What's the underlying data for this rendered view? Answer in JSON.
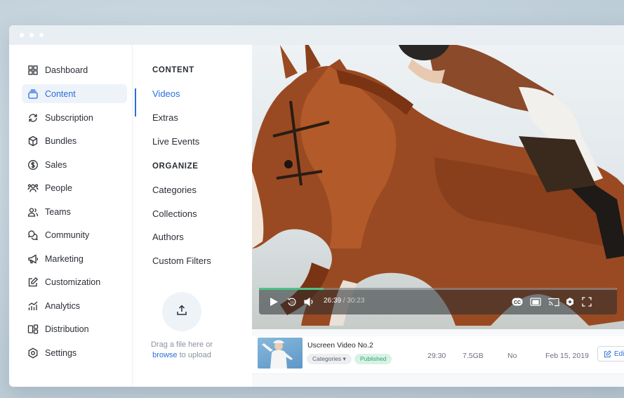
{
  "colors": {
    "accent": "#2a6fdb",
    "progress": "#4fc184",
    "published": "#2ea56b"
  },
  "sidebar": {
    "items": [
      {
        "label": "Dashboard",
        "icon": "dashboard-grid-icon"
      },
      {
        "label": "Content",
        "icon": "layers-icon",
        "active": true
      },
      {
        "label": "Subscription",
        "icon": "refresh-icon"
      },
      {
        "label": "Bundles",
        "icon": "box-icon"
      },
      {
        "label": "Sales",
        "icon": "dollar-circle-icon"
      },
      {
        "label": "People",
        "icon": "people-icon"
      },
      {
        "label": "Teams",
        "icon": "team-icon"
      },
      {
        "label": "Community",
        "icon": "chat-bubbles-icon"
      },
      {
        "label": "Marketing",
        "icon": "megaphone-icon"
      },
      {
        "label": "Customization",
        "icon": "edit-square-icon"
      },
      {
        "label": "Analytics",
        "icon": "analytics-icon"
      },
      {
        "label": "Distribution",
        "icon": "distribution-icon"
      },
      {
        "label": "Settings",
        "icon": "settings-hexagon-icon"
      }
    ]
  },
  "subnav": {
    "content_heading": "CONTENT",
    "content_items": [
      "Videos",
      "Extras",
      "Live Events"
    ],
    "organize_heading": "ORGANIZE",
    "organize_items": [
      "Categories",
      "Collections",
      "Authors",
      "Custom Filters"
    ],
    "upload": {
      "line1": "Drag a file here or",
      "link": "browse",
      "line2": " to upload"
    }
  },
  "player": {
    "current_time": "26:39",
    "separator": " / ",
    "duration": "30:23",
    "progress_fraction": 0.18
  },
  "table": {
    "rows": [
      {
        "title": "Uscreen Video No.2",
        "category": "Categories",
        "status": "Published",
        "duration": "29:30",
        "size": "7.5GB",
        "flag": "No",
        "date": "Feb 15, 2019",
        "action": "Edit"
      }
    ]
  }
}
